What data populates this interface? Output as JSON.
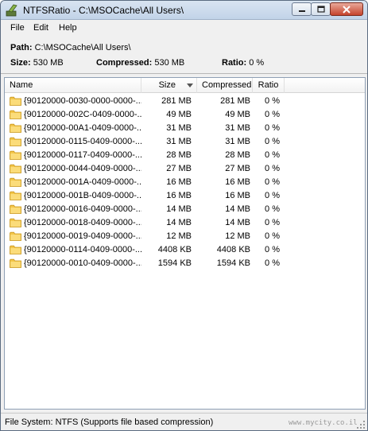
{
  "window": {
    "title": "NTFSRatio - C:\\MSOCache\\All Users\\"
  },
  "menu": [
    "File",
    "Edit",
    "Help"
  ],
  "info": {
    "path_label": "Path:",
    "path_value": "C:\\MSOCache\\All Users\\",
    "size_label": "Size:",
    "size_value": "530 MB",
    "compressed_label": "Compressed:",
    "compressed_value": "530 MB",
    "ratio_label": "Ratio:",
    "ratio_value": "0 %"
  },
  "table": {
    "columns": {
      "name": "Name",
      "size": "Size",
      "compressed": "Compressed",
      "ratio": "Ratio"
    },
    "sorted_column": "size",
    "sort_direction": "descending",
    "rows": [
      {
        "name": "{90120000-0030-0000-0000-...",
        "size": "281 MB",
        "compressed": "281 MB",
        "ratio": "0 %"
      },
      {
        "name": "{90120000-002C-0409-0000-...",
        "size": "49 MB",
        "compressed": "49 MB",
        "ratio": "0 %"
      },
      {
        "name": "{90120000-00A1-0409-0000-...",
        "size": "31 MB",
        "compressed": "31 MB",
        "ratio": "0 %"
      },
      {
        "name": "{90120000-0115-0409-0000-...",
        "size": "31 MB",
        "compressed": "31 MB",
        "ratio": "0 %"
      },
      {
        "name": "{90120000-0117-0409-0000-...",
        "size": "28 MB",
        "compressed": "28 MB",
        "ratio": "0 %"
      },
      {
        "name": "{90120000-0044-0409-0000-...",
        "size": "27 MB",
        "compressed": "27 MB",
        "ratio": "0 %"
      },
      {
        "name": "{90120000-001A-0409-0000-...",
        "size": "16 MB",
        "compressed": "16 MB",
        "ratio": "0 %"
      },
      {
        "name": "{90120000-001B-0409-0000-...",
        "size": "16 MB",
        "compressed": "16 MB",
        "ratio": "0 %"
      },
      {
        "name": "{90120000-0016-0409-0000-...",
        "size": "14 MB",
        "compressed": "14 MB",
        "ratio": "0 %"
      },
      {
        "name": "{90120000-0018-0409-0000-...",
        "size": "14 MB",
        "compressed": "14 MB",
        "ratio": "0 %"
      },
      {
        "name": "{90120000-0019-0409-0000-...",
        "size": "12 MB",
        "compressed": "12 MB",
        "ratio": "0 %"
      },
      {
        "name": "{90120000-0114-0409-0000-...",
        "size": "4408 KB",
        "compressed": "4408 KB",
        "ratio": "0 %"
      },
      {
        "name": "{90120000-0010-0409-0000-...",
        "size": "1594 KB",
        "compressed": "1594 KB",
        "ratio": "0 %"
      }
    ]
  },
  "status": {
    "text": "File System: NTFS    (Supports file based compression)",
    "watermark": "www.mycity.co.il"
  },
  "icons": {
    "app": "ntfsratio-app-icon",
    "row": "folder-icon",
    "sort": "sort-descending-icon"
  },
  "colors": {
    "folder": "#f3c64a",
    "title_bar": "#c9d8eb",
    "close_button": "#c5432c"
  }
}
